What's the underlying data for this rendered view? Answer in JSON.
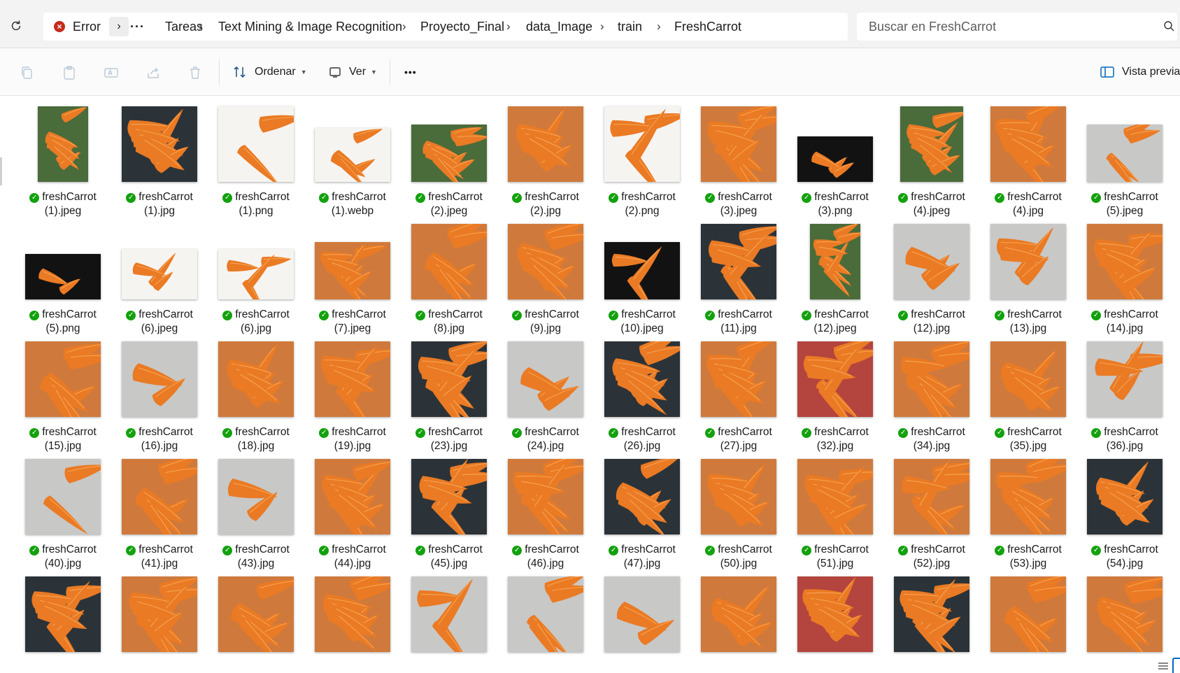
{
  "address_bar": {
    "error_label": "Error",
    "ellipsis": "···",
    "crumbs": [
      "Tareas",
      "Text Mining & Image Recognition",
      "Proyecto_Final",
      "data_Image",
      "train",
      "FreshCarrot"
    ],
    "search_placeholder": "Buscar en FreshCarrot"
  },
  "command_bar": {
    "sort_label": "Ordenar",
    "view_label": "Ver",
    "more_label": "•••",
    "preview_label": "Vista previa"
  },
  "colors": {
    "accent": "#0067c0",
    "sync_ok": "#13a10e",
    "error": "#c42b1c"
  },
  "files": [
    {
      "name": "freshCarrot",
      "ext": "(1).jpeg"
    },
    {
      "name": "freshCarrot",
      "ext": "(1).jpg"
    },
    {
      "name": "freshCarrot",
      "ext": "(1).png"
    },
    {
      "name": "freshCarrot",
      "ext": "(1).webp"
    },
    {
      "name": "freshCarrot",
      "ext": "(2).jpeg"
    },
    {
      "name": "freshCarrot",
      "ext": "(2).jpg"
    },
    {
      "name": "freshCarrot",
      "ext": "(2).png"
    },
    {
      "name": "freshCarrot",
      "ext": "(3).jpeg"
    },
    {
      "name": "freshCarrot",
      "ext": "(3).png"
    },
    {
      "name": "freshCarrot",
      "ext": "(4).jpeg"
    },
    {
      "name": "freshCarrot",
      "ext": "(4).jpg"
    },
    {
      "name": "freshCarrot",
      "ext": "(5).jpeg"
    },
    {
      "name": "freshCarrot",
      "ext": "(5).png"
    },
    {
      "name": "freshCarrot",
      "ext": "(6).jpeg"
    },
    {
      "name": "freshCarrot",
      "ext": "(6).jpg"
    },
    {
      "name": "freshCarrot",
      "ext": "(7).jpeg"
    },
    {
      "name": "freshCarrot",
      "ext": "(8).jpg"
    },
    {
      "name": "freshCarrot",
      "ext": "(9).jpg"
    },
    {
      "name": "freshCarrot",
      "ext": "(10).jpeg"
    },
    {
      "name": "freshCarrot",
      "ext": "(11).jpg"
    },
    {
      "name": "freshCarrot",
      "ext": "(12).jpeg"
    },
    {
      "name": "freshCarrot",
      "ext": "(12).jpg"
    },
    {
      "name": "freshCarrot",
      "ext": "(13).jpg"
    },
    {
      "name": "freshCarrot",
      "ext": "(14).jpg"
    },
    {
      "name": "freshCarrot",
      "ext": "(15).jpg"
    },
    {
      "name": "freshCarrot",
      "ext": "(16).jpg"
    },
    {
      "name": "freshCarrot",
      "ext": "(18).jpg"
    },
    {
      "name": "freshCarrot",
      "ext": "(19).jpg"
    },
    {
      "name": "freshCarrot",
      "ext": "(23).jpg"
    },
    {
      "name": "freshCarrot",
      "ext": "(24).jpg"
    },
    {
      "name": "freshCarrot",
      "ext": "(26).jpg"
    },
    {
      "name": "freshCarrot",
      "ext": "(27).jpg"
    },
    {
      "name": "freshCarrot",
      "ext": "(32).jpg"
    },
    {
      "name": "freshCarrot",
      "ext": "(34).jpg"
    },
    {
      "name": "freshCarrot",
      "ext": "(35).jpg"
    },
    {
      "name": "freshCarrot",
      "ext": "(36).jpg"
    },
    {
      "name": "freshCarrot",
      "ext": "(40).jpg"
    },
    {
      "name": "freshCarrot",
      "ext": "(41).jpg"
    },
    {
      "name": "freshCarrot",
      "ext": "(43).jpg"
    },
    {
      "name": "freshCarrot",
      "ext": "(44).jpg"
    },
    {
      "name": "freshCarrot",
      "ext": "(45).jpg"
    },
    {
      "name": "freshCarrot",
      "ext": "(46).jpg"
    },
    {
      "name": "freshCarrot",
      "ext": "(47).jpg"
    },
    {
      "name": "freshCarrot",
      "ext": "(50).jpg"
    },
    {
      "name": "freshCarrot",
      "ext": "(51).jpg"
    },
    {
      "name": "freshCarrot",
      "ext": "(52).jpg"
    },
    {
      "name": "freshCarrot",
      "ext": "(53).jpg"
    },
    {
      "name": "freshCarrot",
      "ext": "(54).jpg"
    },
    {
      "name": "",
      "ext": ""
    },
    {
      "name": "",
      "ext": ""
    },
    {
      "name": "",
      "ext": ""
    },
    {
      "name": "",
      "ext": ""
    },
    {
      "name": "",
      "ext": ""
    },
    {
      "name": "",
      "ext": ""
    },
    {
      "name": "",
      "ext": ""
    },
    {
      "name": "",
      "ext": ""
    },
    {
      "name": "",
      "ext": ""
    },
    {
      "name": "",
      "ext": ""
    },
    {
      "name": "",
      "ext": ""
    },
    {
      "name": "",
      "ext": ""
    }
  ]
}
